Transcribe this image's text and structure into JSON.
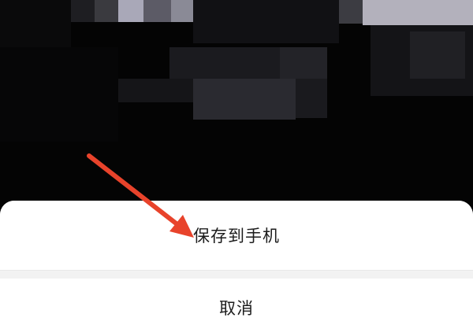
{
  "action_sheet": {
    "save_label": "保存到手机",
    "cancel_label": "取消"
  },
  "annotation": {
    "arrow_color": "#e8432b"
  }
}
